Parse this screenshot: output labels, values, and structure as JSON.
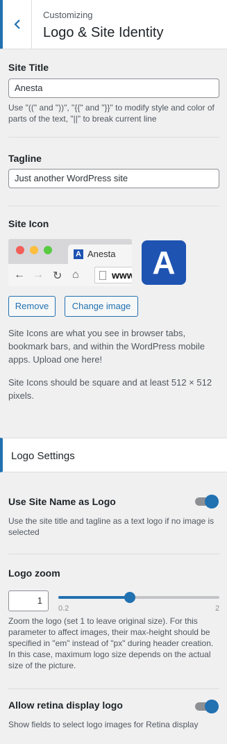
{
  "header": {
    "crumb": "Customizing",
    "title": "Logo & Site Identity"
  },
  "site_title": {
    "label": "Site Title",
    "value": "Anesta",
    "help": "Use \"((\" and \"))\", \"{{\" and \"}}\" to modify style and color of parts of the text, \"||\" to break current line"
  },
  "tagline": {
    "label": "Tagline",
    "value": "Just another WordPress site"
  },
  "site_icon": {
    "label": "Site Icon",
    "preview_tab_name": "Anesta",
    "preview_url": "www.",
    "icon_letter": "A",
    "remove_label": "Remove",
    "change_label": "Change image",
    "help1": "Site Icons are what you see in browser tabs, bookmark bars, and within the WordPress mobile apps. Upload one here!",
    "help2": "Site Icons should be square and at least 512 × 512 pixels."
  },
  "logo_settings": {
    "title": "Logo Settings",
    "use_site_name": {
      "label": "Use Site Name as Logo",
      "help": "Use the site title and tagline as a text logo if no image is selected",
      "enabled": true
    },
    "logo_zoom": {
      "label": "Logo zoom",
      "value": "1",
      "min": "0.2",
      "max": "2",
      "help": "Zoom the logo (set 1 to leave original size). For this parameter to affect images, their max-height should be specified in \"em\" instead of \"px\" during header creation. In this case, maximum logo size depends on the actual size of the picture."
    },
    "retina": {
      "label": "Allow retina display logo",
      "help": "Show fields to select logo images for Retina display",
      "enabled": true
    }
  },
  "colors": {
    "accent": "#2271b1",
    "icon_bg": "#1e53b2"
  }
}
